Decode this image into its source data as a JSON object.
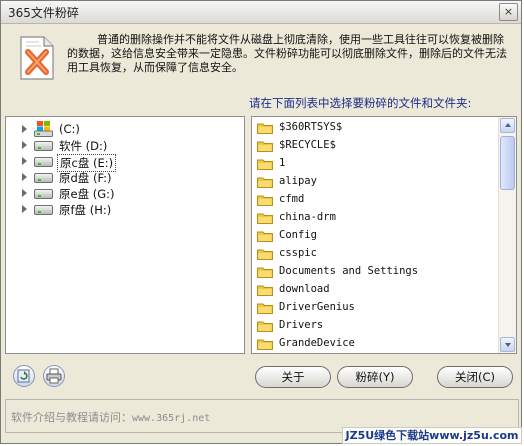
{
  "window": {
    "title": "365文件粉碎",
    "close_label": "×"
  },
  "description": "普通的删除操作并不能将文件从磁盘上彻底清除，使用一些工具往往可以恢复被删除的数据，这给信息安全带来一定隐患。文件粉碎功能可以彻底删除文件，删除后的文件无法用工具恢复，从而保障了信息安全。",
  "list_heading": "请在下面列表中选择要粉碎的文件和文件夹:",
  "drive_tree": [
    {
      "label": "(C:)",
      "icon": "windows-drive-icon",
      "selected": false
    },
    {
      "label": "软件 (D:)",
      "icon": "drive-icon",
      "selected": false
    },
    {
      "label": "原c盘 (E:)",
      "icon": "drive-icon",
      "selected": true
    },
    {
      "label": "原d盘 (F:)",
      "icon": "drive-icon",
      "selected": false
    },
    {
      "label": "原e盘 (G:)",
      "icon": "drive-icon",
      "selected": false
    },
    {
      "label": "原f盘 (H:)",
      "icon": "drive-icon",
      "selected": false
    }
  ],
  "file_list": [
    {
      "name": "$360RTSYS$"
    },
    {
      "name": "$RECYCLE$"
    },
    {
      "name": "1"
    },
    {
      "name": "alipay"
    },
    {
      "name": "cfmd"
    },
    {
      "name": "china-drm"
    },
    {
      "name": "Config"
    },
    {
      "name": "csspic"
    },
    {
      "name": "Documents and Settings"
    },
    {
      "name": "download"
    },
    {
      "name": "DriverGenius"
    },
    {
      "name": "Drivers"
    },
    {
      "name": "GrandeDevice"
    }
  ],
  "buttons": {
    "about": "关于",
    "shred": "粉碎(Y)",
    "close": "关闭(C)"
  },
  "footer": {
    "prefix": "软件介绍与教程请访问：",
    "url": "www.365rj.net"
  },
  "watermark": "JZ5U绿色下载站www.jz5u.com",
  "colors": {
    "heading_blue": "#1b2d8a",
    "folder_yellow": "#f0c83c",
    "footer_grey": "#8c8c8c"
  }
}
